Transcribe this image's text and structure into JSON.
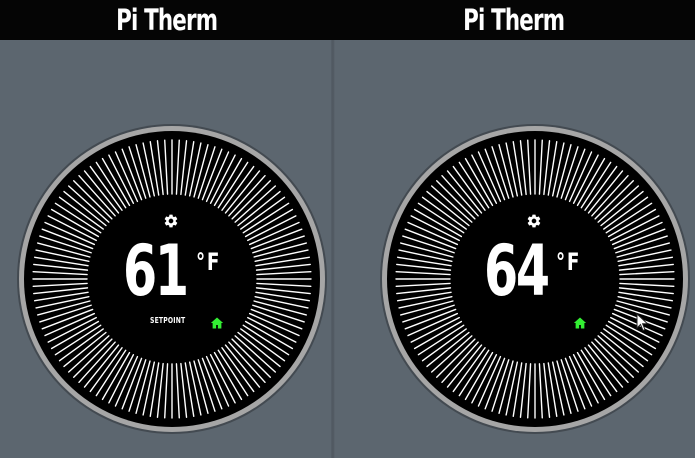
{
  "panels": [
    {
      "title": "Pi Therm",
      "temperature": "61",
      "unit": "°F",
      "mode_label": "SETPOINT",
      "icons": [
        "gear-icon",
        "home-icon"
      ]
    },
    {
      "title": "Pi Therm",
      "temperature": "64",
      "unit": "°F",
      "mode_label": "",
      "icons": [
        "gear-icon",
        "home-icon",
        "mouse-cursor-icon"
      ]
    }
  ],
  "colors": {
    "background": "#5c666f",
    "header": "#050505",
    "dial_face": "#000000",
    "dial_ring": "#9a9a9a",
    "tick": "#ffffff",
    "home_accent": "#33ee33",
    "text": "#ffffff"
  }
}
